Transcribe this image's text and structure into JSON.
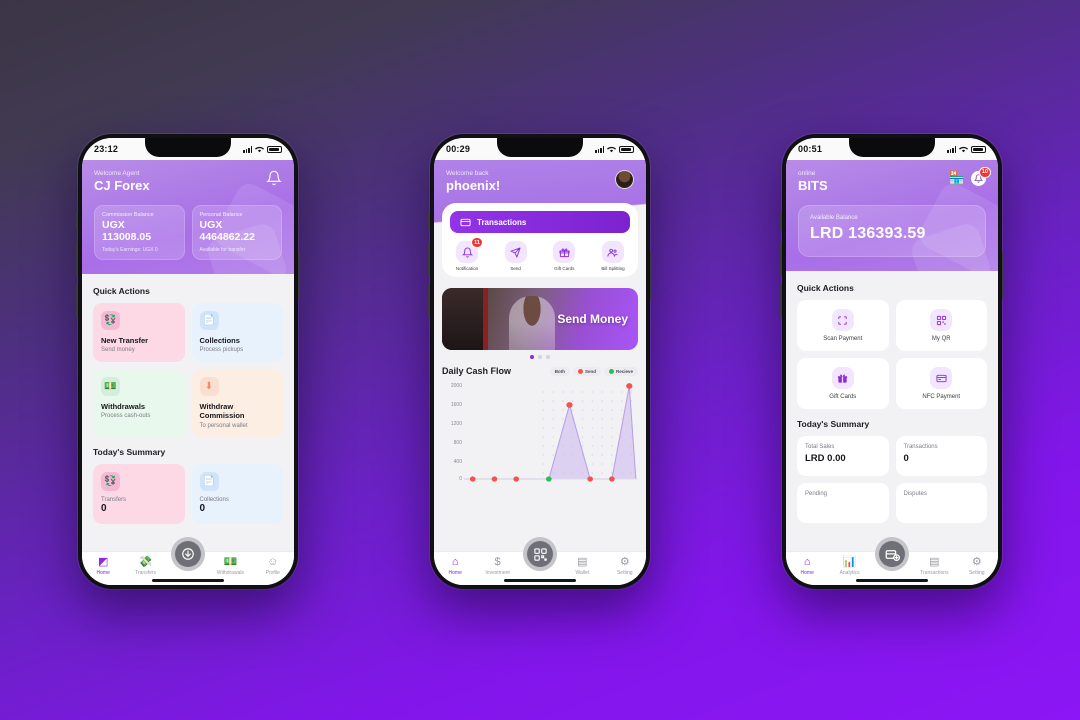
{
  "background": {
    "from": "#3b3546",
    "to": "#8c16f5"
  },
  "phones": [
    {
      "id": "agent-dashboard",
      "status_bar": {
        "time": "23:12"
      },
      "header": {
        "kicker": "Welcome Agent",
        "name": "CJ Forex",
        "bell_icon": "bell-icon",
        "balances": [
          {
            "label": "Commission Balance",
            "currency": "UGX",
            "amount": "113008.05",
            "sub": "Today's Earnings: UGX 0"
          },
          {
            "label": "Personal Balance",
            "currency": "UGX",
            "amount": "4464862.22",
            "sub": "Available for transfer"
          }
        ]
      },
      "quick_actions_title": "Quick Actions",
      "quick_actions": [
        {
          "title": "New Transfer",
          "sub": "Send money",
          "icon": "money-transfer-icon",
          "glyph": "💱",
          "bg": "#fcd9e4",
          "icon_bg": "#f3b9d4"
        },
        {
          "title": "Collections",
          "sub": "Process pickups",
          "icon": "document-icon",
          "glyph": "📄",
          "bg": "#e8f2fc",
          "icon_bg": "#cfe4f8"
        },
        {
          "title": "Withdrawals",
          "sub": "Process cash-outs",
          "icon": "wallet-icon",
          "glyph": "💵",
          "bg": "#e9f8ec",
          "icon_bg": "#d3eedb"
        },
        {
          "title": "Withdraw Commission",
          "sub": "To personal wallet",
          "icon": "download-arrow-icon",
          "glyph": "⬇",
          "bg": "#fdeee4",
          "icon_bg": "#f9dfd0"
        }
      ],
      "summary_title": "Today's Summary",
      "summary": [
        {
          "title": "Transfers",
          "value": "0",
          "icon": "money-transfer-icon",
          "glyph": "💱",
          "bg": "#fcd9e4",
          "icon_bg": "#f3b9d4"
        },
        {
          "title": "Collections",
          "value": "0",
          "icon": "document-icon",
          "glyph": "📄",
          "bg": "#e8f2fc",
          "icon_bg": "#cfe4f8"
        }
      ],
      "fab": {
        "icon": "download-circle-icon",
        "glyph": "⬇"
      },
      "nav": [
        {
          "label": "Home",
          "icon": "home-icon",
          "glyph": "◩",
          "active": true
        },
        {
          "label": "Transfers",
          "icon": "transfers-icon",
          "glyph": "💸",
          "active": false
        },
        {
          "label": "Withdrawals",
          "icon": "withdrawals-icon",
          "glyph": "💵",
          "active": false
        },
        {
          "label": "Profile",
          "icon": "profile-icon",
          "glyph": "☺",
          "active": false
        }
      ]
    },
    {
      "id": "wallet-home",
      "status_bar": {
        "time": "00:29"
      },
      "header": {
        "kicker": "Welcome back",
        "name": "phoenix!",
        "avatar_icon": "user-avatar"
      },
      "transactions_button": {
        "label": "Transactions",
        "icon": "card-icon",
        "glyph": "▤"
      },
      "actions": [
        {
          "label": "Notification",
          "icon": "bell-icon",
          "glyph": "🔔",
          "badge": "11"
        },
        {
          "label": "Send",
          "icon": "send-icon",
          "glyph": "➤",
          "badge": ""
        },
        {
          "label": "Gift Cards",
          "icon": "gift-icon",
          "glyph": "🎁",
          "badge": ""
        },
        {
          "label": "Bill Splitting",
          "icon": "people-icon",
          "glyph": "👥",
          "badge": ""
        }
      ],
      "banner": {
        "text": "Send Money",
        "dots": 3,
        "active_dot": 0
      },
      "fab": {
        "icon": "qr-scan-icon",
        "glyph": "⬚"
      },
      "nav": [
        {
          "label": "Home",
          "icon": "home-icon",
          "glyph": "⌂",
          "active": true
        },
        {
          "label": "Investment",
          "icon": "dollar-icon",
          "glyph": "$",
          "active": false
        },
        {
          "label": "Wallet",
          "icon": "wallet-card-icon",
          "glyph": "▤",
          "active": false
        },
        {
          "label": "Setting",
          "icon": "gear-icon",
          "glyph": "⚙",
          "active": false
        }
      ],
      "chart_data": {
        "type": "area",
        "title": "Daily Cash Flow",
        "legend": [
          {
            "label": "Both",
            "color": "#8a8a95",
            "selected": true
          },
          {
            "label": "Send",
            "color": "#f0544f",
            "selected": false
          },
          {
            "label": "Recieve",
            "color": "#2bbd5a",
            "selected": false
          }
        ],
        "legend_position": "top-right",
        "grid": true,
        "xlabel": "",
        "ylabel": "",
        "ylim": [
          0,
          2000
        ],
        "yticks": [
          0,
          400,
          800,
          1200,
          1600,
          2000
        ],
        "x": [
          1,
          2,
          3,
          4,
          5,
          6,
          7,
          8,
          9
        ],
        "series": [
          {
            "name": "Send",
            "color": "#f0544f",
            "values": [
              0,
              0,
              0,
              0,
              0,
              1550,
              0,
              0,
              1950
            ]
          },
          {
            "name": "Recieve",
            "color": "#2bbd5a",
            "values": [
              0,
              0,
              0,
              0,
              0,
              0,
              0,
              0,
              0
            ]
          }
        ],
        "markers": [
          {
            "x": 1,
            "y": 0,
            "color": "#f0544f"
          },
          {
            "x": 2,
            "y": 0,
            "color": "#f0544f"
          },
          {
            "x": 3,
            "y": 0,
            "color": "#f0544f"
          },
          {
            "x": 4,
            "y": 0,
            "color": "#2bbd5a"
          },
          {
            "x": 5,
            "y": 0,
            "color": "#f0544f"
          },
          {
            "x": 6,
            "y": 1550,
            "color": "#f0544f"
          },
          {
            "x": 7,
            "y": 0,
            "color": "#f0544f"
          },
          {
            "x": 9,
            "y": 1950,
            "color": "#f0544f"
          }
        ]
      }
    },
    {
      "id": "merchant-home",
      "status_bar": {
        "time": "00:51"
      },
      "header": {
        "kicker": "online",
        "name": "BITS",
        "store_icon": "store-icon",
        "store_glyph": "🏪",
        "bell_icon": "bell-icon",
        "badge": "10",
        "balance": {
          "label": "Available Balance",
          "amount": "LRD 136393.59"
        }
      },
      "quick_actions_title": "Quick Actions",
      "quick_actions": [
        {
          "title": "Scan Payment",
          "icon": "scan-icon",
          "glyph": "⬚"
        },
        {
          "title": "My QR",
          "icon": "qr-code-icon",
          "glyph": "▒"
        },
        {
          "title": "Gift Cards",
          "icon": "gift-icon",
          "glyph": "🎁"
        },
        {
          "title": "NFC Payment",
          "icon": "nfc-card-icon",
          "glyph": "▤"
        }
      ],
      "summary_title": "Today's Summary",
      "summary": [
        {
          "label": "Total Sales",
          "value": "LRD 0.00"
        },
        {
          "label": "Transactions",
          "value": "0"
        },
        {
          "label": "Pending",
          "value": ""
        },
        {
          "label": "Disputes",
          "value": ""
        }
      ],
      "fab": {
        "icon": "new-transaction-icon",
        "glyph": "➕"
      },
      "nav": [
        {
          "label": "Home",
          "icon": "home-icon",
          "glyph": "⌂",
          "active": true
        },
        {
          "label": "Analytics",
          "icon": "analytics-icon",
          "glyph": "📊",
          "active": false
        },
        {
          "label": "Transactions",
          "icon": "transactions-icon",
          "glyph": "▤",
          "active": false
        },
        {
          "label": "Setting",
          "icon": "gear-icon",
          "glyph": "⚙",
          "active": false
        }
      ]
    }
  ]
}
